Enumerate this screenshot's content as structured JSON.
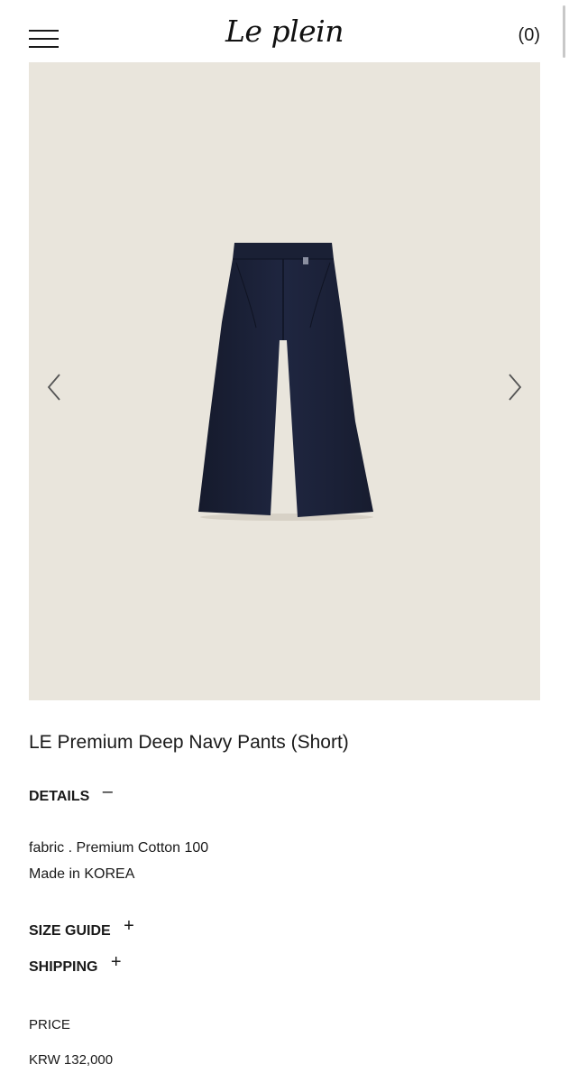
{
  "header": {
    "logo_text": "Le plein",
    "cart_label": "(0)",
    "menu_icon": "hamburger-menu-icon"
  },
  "gallery": {
    "background_color": "#e9e5dc",
    "product_color": "#1c2237",
    "prev_icon": "chevron-left-icon",
    "next_icon": "chevron-right-icon"
  },
  "product": {
    "title": "LE Premium Deep Navy Pants (Short)",
    "details": {
      "heading": "DETAILS",
      "toggle": "–",
      "lines": [
        "fabric . Premium Cotton 100",
        "Made in KOREA"
      ]
    },
    "size_guide": {
      "heading": "SIZE GUIDE",
      "toggle": "+"
    },
    "shipping": {
      "heading": "SHIPPING",
      "toggle": "+"
    },
    "price": {
      "label": "PRICE",
      "value": "KRW 132,000"
    }
  }
}
